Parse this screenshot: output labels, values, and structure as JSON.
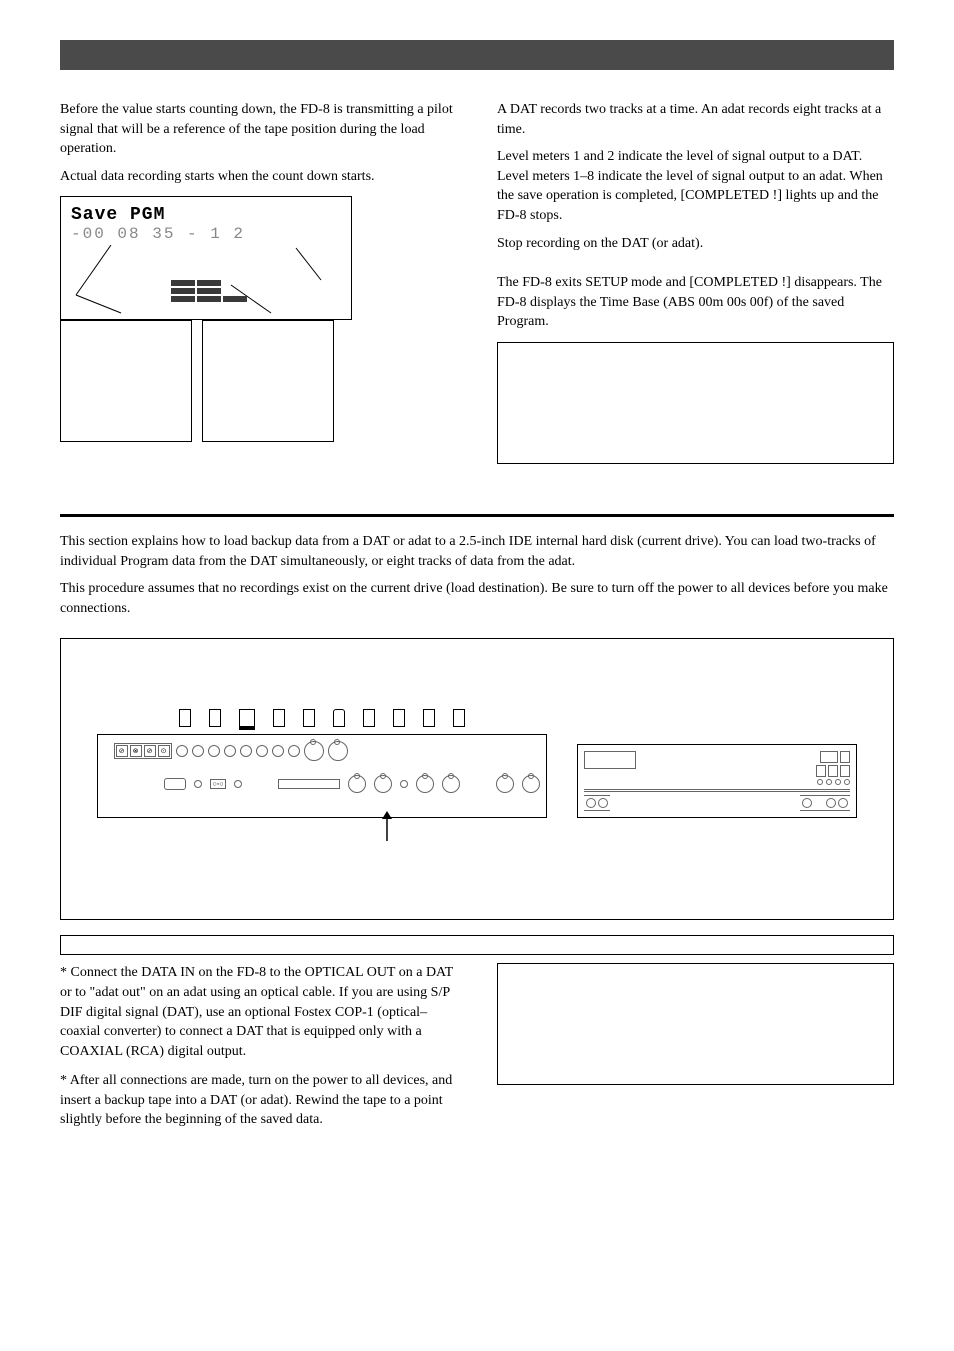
{
  "page_header_bar": "",
  "left_col": {
    "p1": "Before the value starts counting down, the FD-8 is transmitting a pilot signal that will be a reference of the tape position during the load operation.",
    "p2": "Actual data recording starts when the count down starts.",
    "lcd_title": "Save PGM",
    "lcd_digits": "-00  08  35  - 1   2"
  },
  "right_col": {
    "p1": "A DAT records two tracks at a time.  An adat records eight tracks at a time.",
    "p2": "Level meters 1 and 2 indicate the level of signal output to a DAT.  Level meters 1–8 indicate the level of signal output to an adat. When the save operation is completed, [COMPLETED !] lights up and the FD-8 stops.",
    "p3": "Stop recording on the DAT (or adat).",
    "p4": "The FD-8 exits SETUP mode and [COMPLETED !] disappears.  The FD-8 displays the Time Base (ABS 00m 00s 00f) of the saved Program."
  },
  "section2": {
    "intro1": "This section explains how to load backup data from a DAT or adat to a 2.5-inch IDE internal hard disk (current drive). You can load two-tracks of individual Program data from the DAT simultaneously, or eight tracks of data from the adat.",
    "intro2": "This procedure assumes that no recordings exist on the current drive (load destination).  Be sure to turn off the power to all devices before you make connections."
  },
  "bottom": {
    "p1": "* Connect the DATA IN on the FD-8 to the OPTICAL OUT on a DAT or to \"adat out\" on an adat using an optical cable.  If you are using S/P DIF digital signal (DAT), use an optional Fostex COP-1 (optical–coaxial converter) to connect a DAT that is equipped only with a COAXIAL (RCA) digital output.",
    "p2": "* After all connections are made, turn on the power to all devices, and insert a backup tape into a DAT (or adat).  Rewind the tape to a point slightly before the beginning of the saved data."
  }
}
